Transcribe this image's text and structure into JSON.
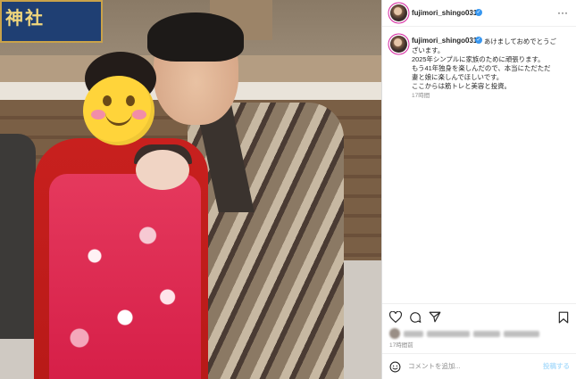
{
  "post": {
    "username": "fujimori_shingo0317",
    "more_label": "···",
    "caption_lines": [
      "あけましておめでとうご",
      "ざいます。",
      "2025年シンプルに家族のために頑張ります。",
      "もう41年独身を楽しんだので、本当にただただ",
      "妻と娘に楽しんでほしいです。",
      "ここからは筋トレと美容と投資。"
    ],
    "caption_time": "17時間",
    "post_time": "17時間前",
    "photo_sign_text": "神社"
  },
  "comment": {
    "placeholder": "コメントを追加...",
    "post_label": "投稿する"
  },
  "icons": {
    "heart": "heart-icon",
    "comment": "comment-icon",
    "share": "share-icon",
    "bookmark": "bookmark-icon",
    "emoji": "emoji-icon",
    "verified": "verified-badge-icon",
    "more": "more-options-icon"
  },
  "colors": {
    "verified": "#3897f0",
    "post_button_disabled": "#b2dffc",
    "muted_text": "#8e8e8e"
  }
}
